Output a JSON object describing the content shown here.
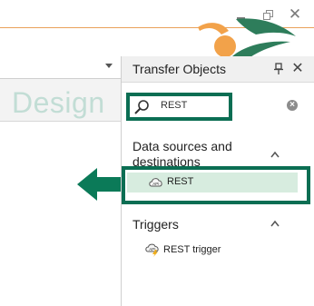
{
  "window": {
    "minimize_icon": "minimize-icon",
    "restore_icon": "restore-icon",
    "close_label": "✕"
  },
  "editor": {
    "design_label": "Design"
  },
  "panel": {
    "title": "Transfer Objects",
    "close_label": "✕",
    "search": {
      "value": "REST",
      "clear_label": "×"
    },
    "sections": [
      {
        "title": "Data sources and destinations",
        "items": [
          {
            "label": "REST",
            "icon": "rest-api-icon",
            "selected": true
          }
        ]
      },
      {
        "title": "Triggers",
        "items": [
          {
            "label": "REST trigger",
            "icon": "rest-trigger-icon",
            "selected": false
          }
        ]
      }
    ]
  },
  "colors": {
    "accent_green": "#0b6e53",
    "selection_fill": "#d7ecdf",
    "design_text": "#c2ddd5",
    "divider_orange": "#e9a15a"
  }
}
